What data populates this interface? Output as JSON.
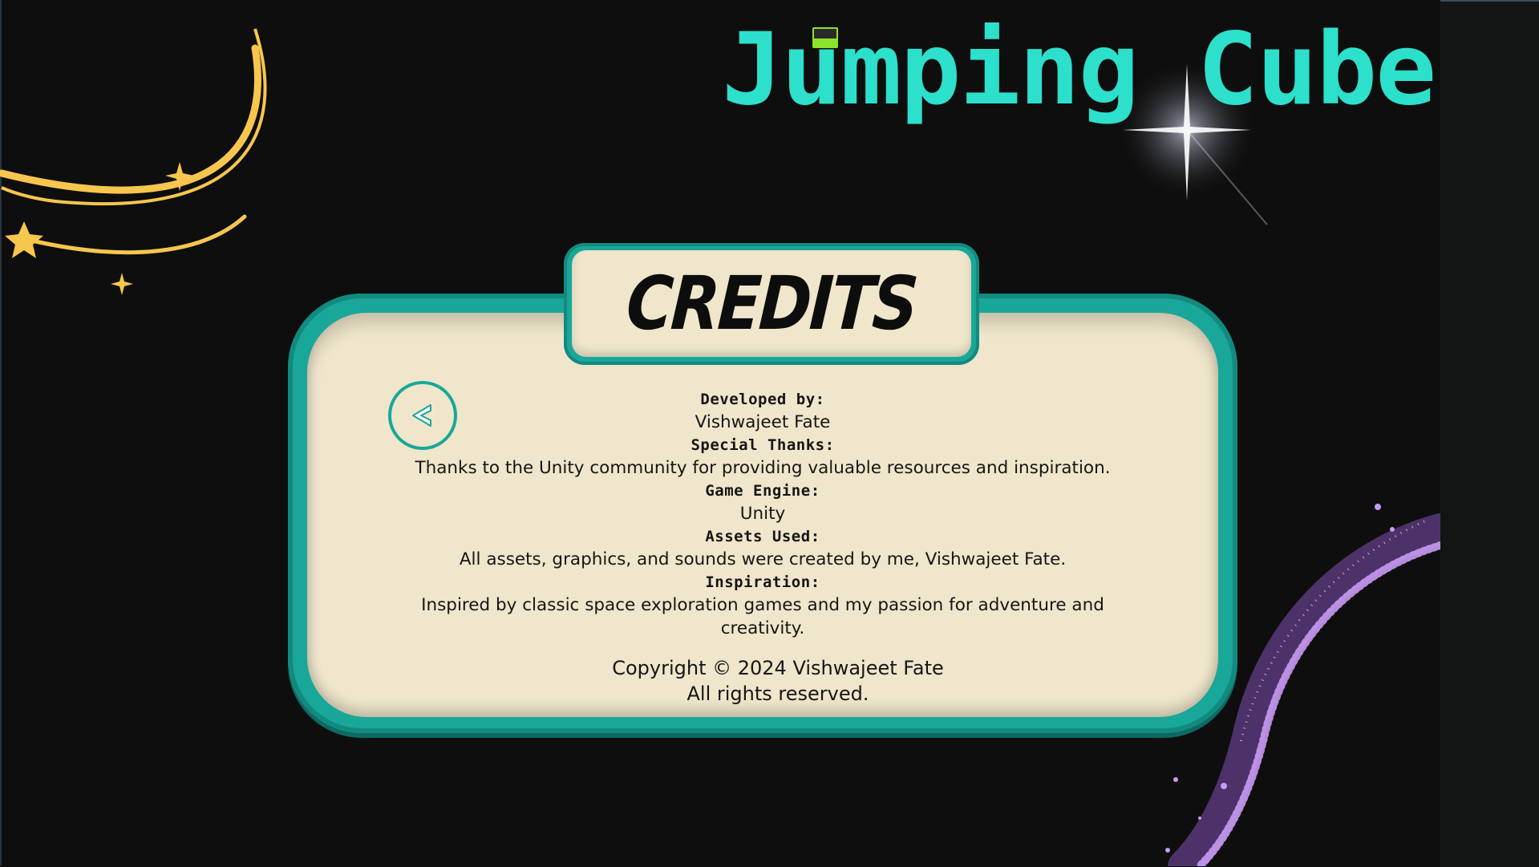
{
  "game_title": "Jumping Cube",
  "panel": {
    "heading": "CREDITS",
    "back_icon": "chevron-left-icon",
    "sections": [
      {
        "label": "Developed by:",
        "value": "Vishwajeet Fate"
      },
      {
        "label": "Special Thanks:",
        "value": "Thanks to the Unity community for providing valuable resources and inspiration."
      },
      {
        "label": "Game Engine:",
        "value": "Unity"
      },
      {
        "label": "Assets Used:",
        "value": "All assets, graphics, and sounds were created by me, Vishwajeet Fate."
      },
      {
        "label": "Inspiration:",
        "value": "Inspired by classic space exploration games and my passion for adventure and creativity."
      }
    ],
    "copyright_line1": "Copyright © 2024 Vishwajeet Fate",
    "copyright_line2": "All rights reserved."
  },
  "colors": {
    "background": "#0e0e0e",
    "title": "#2ce0cc",
    "panel_border": "#19a799",
    "panel_fill": "#efe6cb",
    "star_gold": "#f7c64e",
    "glitter_purple": "#b07ae8"
  }
}
